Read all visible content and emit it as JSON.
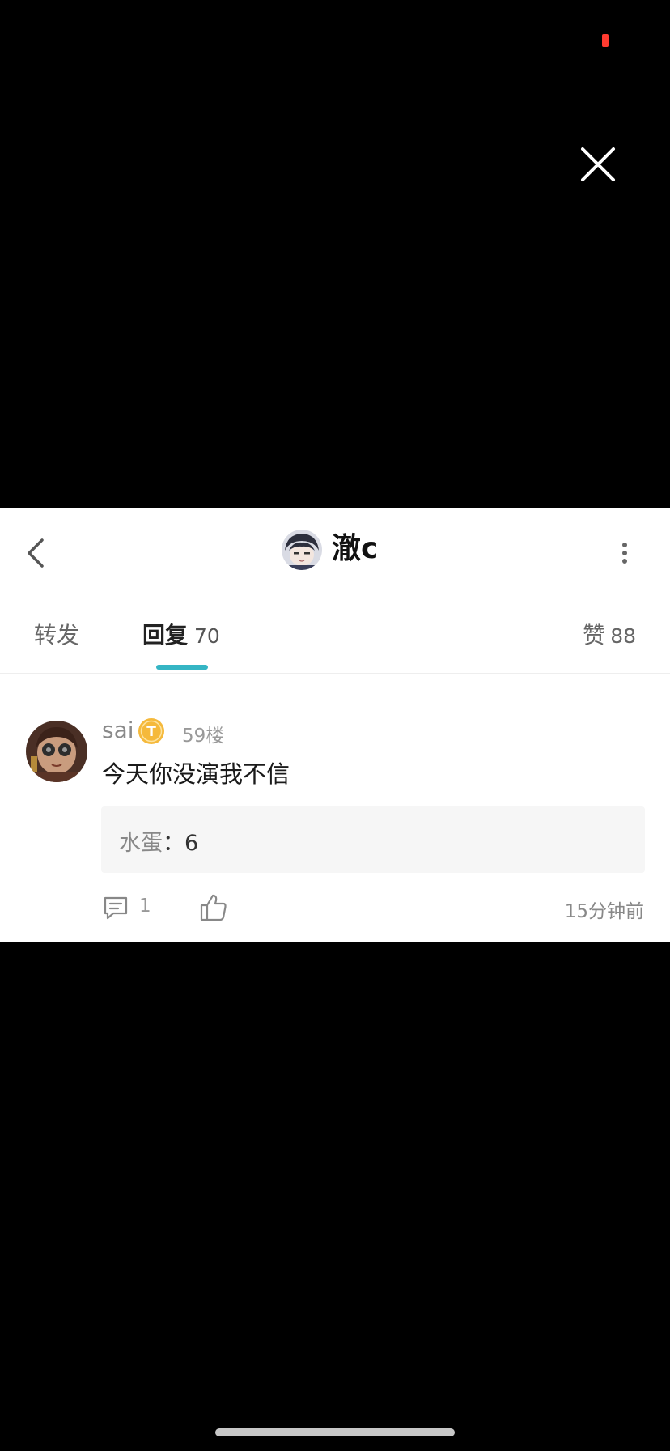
{
  "colors": {
    "accent": "#35b5c4",
    "status_dot": "#ff3b30",
    "background": "#000000",
    "card": "#ffffff"
  },
  "header": {
    "title": "澈c",
    "back_icon": "chevron-left-icon",
    "more_icon": "more-vertical-icon"
  },
  "tabs": {
    "forward_label": "转发",
    "reply_label": "回复",
    "reply_count": "70",
    "like_label": "赞",
    "like_count": "88",
    "active": "回复"
  },
  "comment": {
    "username": "sai",
    "badge_letter": "T",
    "floor": "59楼",
    "text": "今天你没演我不信",
    "reply": {
      "author": "水蛋",
      "separator": "：",
      "text": "6"
    },
    "reply_count": "1",
    "time": "15分钟前"
  }
}
